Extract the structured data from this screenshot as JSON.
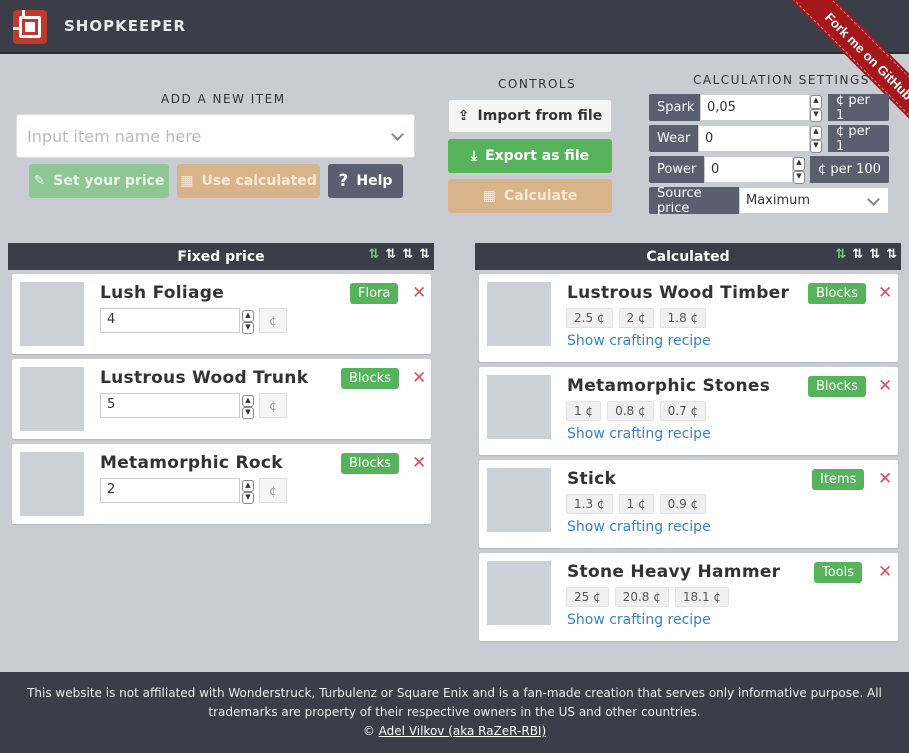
{
  "app": {
    "title": "SHOPKEEPER",
    "ribbon": "Fork me on GitHub"
  },
  "add_item": {
    "title": "ADD A NEW ITEM",
    "placeholder": "Input item name here",
    "set_price": "Set your price",
    "use_calculated": "Use calculated",
    "help": "Help"
  },
  "controls": {
    "title": "CONTROLS",
    "import": "Import from file",
    "export": "Export as file",
    "calculate": "Calculate"
  },
  "settings": {
    "title": "CALCULATION SETTINGS",
    "rows": [
      {
        "label": "Spark",
        "value": "0,05",
        "unit": "¢ per 1"
      },
      {
        "label": "Wear",
        "value": "0",
        "unit": "¢ per 1"
      },
      {
        "label": "Power",
        "value": "0",
        "unit": "¢ per 100"
      }
    ],
    "source_label": "Source price",
    "source_value": "Maximum"
  },
  "fixed": {
    "title": "Fixed price",
    "items": [
      {
        "name": "Lush Foliage",
        "value": "4",
        "tag": "Flora",
        "currency": "¢"
      },
      {
        "name": "Lustrous Wood Trunk",
        "value": "5",
        "tag": "Blocks",
        "currency": "¢"
      },
      {
        "name": "Metamorphic Rock",
        "value": "2",
        "tag": "Blocks",
        "currency": "¢"
      }
    ]
  },
  "calculated": {
    "title": "Calculated",
    "recipe_link": "Show crafting recipe",
    "items": [
      {
        "name": "Lustrous Wood Timber",
        "tag": "Blocks",
        "prices": [
          "2.5 ¢",
          "2 ¢",
          "1.8 ¢"
        ]
      },
      {
        "name": "Metamorphic Stones",
        "tag": "Blocks",
        "prices": [
          "1 ¢",
          "0.8 ¢",
          "0.7 ¢"
        ]
      },
      {
        "name": "Stick",
        "tag": "Items",
        "prices": [
          "1.3 ¢",
          "1 ¢",
          "0.9 ¢"
        ]
      },
      {
        "name": "Stone Heavy Hammer",
        "tag": "Tools",
        "prices": [
          "25 ¢",
          "20.8 ¢",
          "18.1 ¢"
        ]
      }
    ]
  },
  "footer": {
    "line1": "This website is not affiliated with Wonderstruck, Turbulenz or Square Enix and is a fan-made creation that serves only informative purpose. All trademarks are property of their respective owners in the US and other countries.",
    "copyright": "©",
    "author": "Adel Vilkov (aka RaZeR-RBI)"
  },
  "colors": {
    "header": "#3b3e48",
    "accent_green": "#56b35c",
    "delete_red": "#e04a5c",
    "link": "#3582c4",
    "ribbon": "#a5171b"
  }
}
